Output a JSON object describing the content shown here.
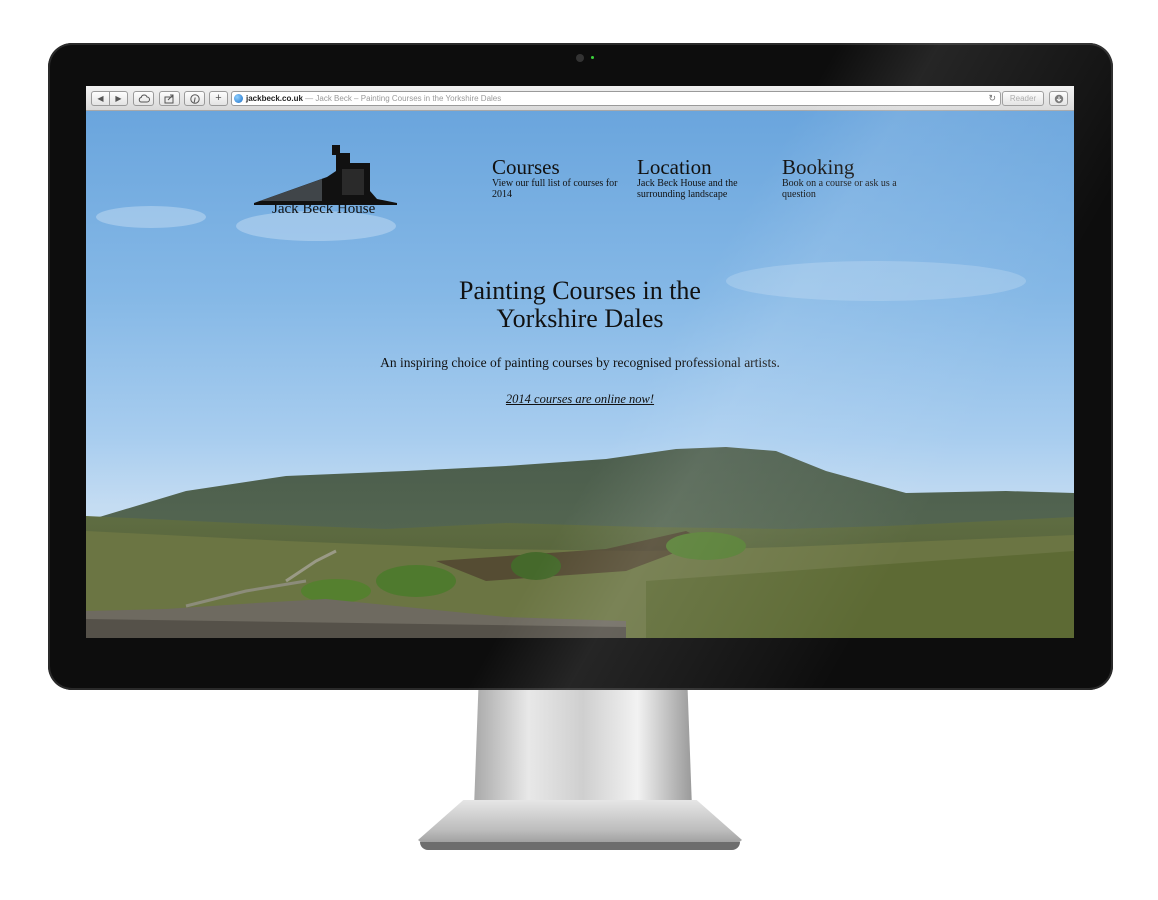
{
  "browser": {
    "url_domain": "jackbeck.co.uk",
    "url_separator": " — ",
    "page_title": "Jack Beck – Painting Courses in the Yorkshire Dales",
    "reader_label": "Reader",
    "add_label": "+"
  },
  "site": {
    "logo_text": "Jack Beck House",
    "nav": [
      {
        "title": "Courses",
        "desc": "View our full list of courses for 2014"
      },
      {
        "title": "Location",
        "desc": "Jack Beck House and the surrounding landscape"
      },
      {
        "title": "Booking",
        "desc": "Book on a course or ask us a question"
      }
    ],
    "hero": {
      "title_line1": "Painting Courses in the",
      "title_line2": "Yorkshire Dales",
      "subtitle": "An inspiring choice of painting courses by recognised professional artists.",
      "link": "2014 courses are online now!"
    }
  },
  "icons": [
    "back-arrow-icon",
    "forward-arrow-icon",
    "cloud-icon",
    "share-icon",
    "pinterest-icon",
    "globe-icon",
    "reload-icon",
    "download-icon"
  ]
}
